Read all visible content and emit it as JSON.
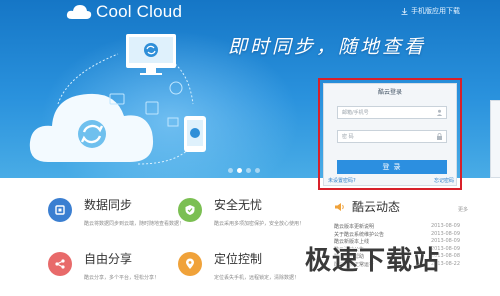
{
  "header": {
    "logo_text": "Cool Cloud",
    "top_link": "手机版应用下载"
  },
  "hero": {
    "slogan": "即时同步，随地查看",
    "carousel": {
      "count": 4,
      "active": 1
    }
  },
  "login": {
    "title": "酷云登录",
    "account_placeholder": "邮箱/手机号",
    "password_placeholder": "密 码",
    "submit_label": "登 录",
    "forgot_label": "未设置密码?",
    "register_label": "忘记密码"
  },
  "features": [
    {
      "title": "数据同步",
      "desc": "酷云将数据同步到云端，随时随地查看数据！",
      "color": "#3b7fd1",
      "icon": "sync-data-icon"
    },
    {
      "title": "安全无忧",
      "desc": "酷云采用多项加密保护，安全放心使用！",
      "color": "#7bbf52",
      "icon": "shield-icon"
    },
    {
      "title": "自由分享",
      "desc": "酷云分享，多个平台，轻松分享！",
      "color": "#e86a6a",
      "icon": "share-icon"
    },
    {
      "title": "定位控制",
      "desc": "定位丢失手机，远程锁定，清除数据！",
      "color": "#f0a23a",
      "icon": "location-icon"
    }
  ],
  "news": {
    "title": "酷云动态",
    "more_label": "更多",
    "items": [
      {
        "text": "酷云版本更新说明",
        "date": "2013-08-09"
      },
      {
        "text": "关于酷云系统维护公告",
        "date": "2013-08-09"
      },
      {
        "text": "酷云新版本上线",
        "date": "2013-08-09"
      },
      {
        "text": "酷云活动公告",
        "date": "2013-08-09"
      },
      {
        "text": "酷云使用帮助",
        "date": "2013-08-08"
      },
      {
        "text": "酷云恢复正常运行",
        "date": "2013-08-22"
      }
    ]
  },
  "watermark": "极速下载站"
}
